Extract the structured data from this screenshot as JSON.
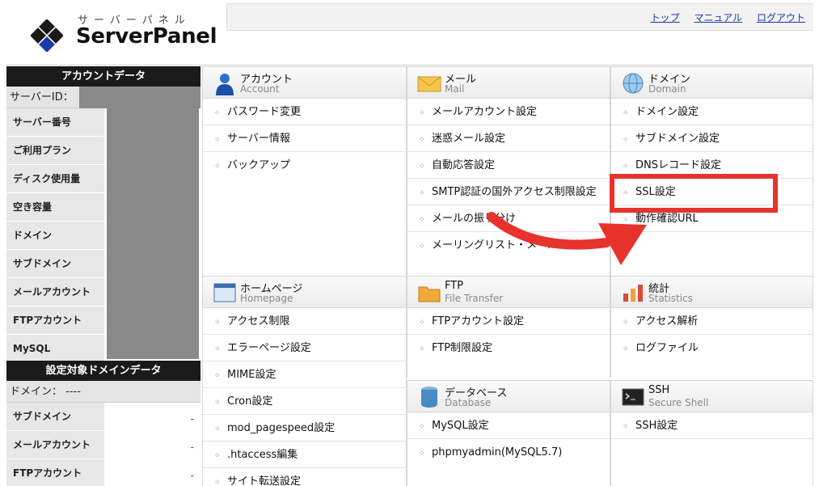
{
  "header": {
    "logo_kana": "サーバーパネル",
    "logo_name": "ServerPanel",
    "links": [
      "トップ",
      "マニュアル",
      "ログアウト"
    ]
  },
  "sidebar": {
    "account_title": "アカウントデータ",
    "server_id_label": "サーバーID：",
    "rows": [
      "サーバー番号",
      "ご利用プラン",
      "ディスク使用量",
      "空き容量",
      "ドメイン",
      "サブドメイン",
      "メールアカウント",
      "FTPアカウント",
      "MySQL"
    ],
    "domain_title": "設定対象ドメインデータ",
    "domain_label": "ドメイン： ----",
    "domain_rows": [
      {
        "k": "サブドメイン",
        "v": "-"
      },
      {
        "k": "メールアカウント",
        "v": "-"
      },
      {
        "k": "FTPアカウント",
        "v": "-"
      }
    ]
  },
  "panels": {
    "account": {
      "title": "アカウント",
      "sub": "Account",
      "items": [
        "パスワード変更",
        "サーバー情報",
        "バックアップ"
      ]
    },
    "mail": {
      "title": "メール",
      "sub": "Mail",
      "items": [
        "メールアカウント設定",
        "迷惑メール設定",
        "自動応答設定",
        "SMTP認証の国外アクセス制限設定",
        "メールの振り分け",
        "メーリングリスト・メールマガジン"
      ]
    },
    "domain": {
      "title": "ドメイン",
      "sub": "Domain",
      "items": [
        "ドメイン設定",
        "サブドメイン設定",
        "DNSレコード設定",
        "SSL設定",
        "動作確認URL"
      ]
    },
    "homepage": {
      "title": "ホームページ",
      "sub": "Homepage",
      "items": [
        "アクセス制限",
        "エラーページ設定",
        "MIME設定",
        "Cron設定",
        "mod_pagespeed設定",
        ".htaccess編集",
        "サイト転送設定"
      ]
    },
    "ftp": {
      "title": "FTP",
      "sub": "File Transfer",
      "items": [
        "FTPアカウント設定",
        "FTP制限設定"
      ]
    },
    "stats": {
      "title": "統計",
      "sub": "Statistics",
      "items": [
        "アクセス解析",
        "ログファイル"
      ]
    },
    "database": {
      "title": "データベース",
      "sub": "Database",
      "items": [
        "MySQL設定",
        "phpmyadmin(MySQL5.7)"
      ]
    },
    "ssh": {
      "title": "SSH",
      "sub": "Secure Shell",
      "items": [
        "SSH設定"
      ]
    }
  },
  "colors": {
    "highlight": "#e8322c",
    "link": "#1a3aa8"
  }
}
